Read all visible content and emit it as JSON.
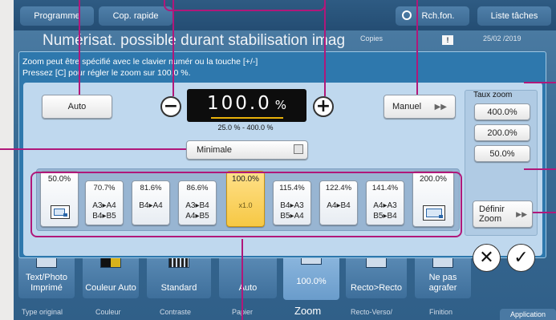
{
  "topbar": {
    "programme": "Programme",
    "cop_rapide": "Cop. rapide",
    "rch_fon": "Rch.fon.",
    "liste_taches": "Liste tâches"
  },
  "title": "Numérisat. possible durant stabilisation imag",
  "copies_label": "Copies",
  "datetime": "25/02 /2019",
  "info_text": [
    "Zoom peut être spécifié avec le clavier numér ou la touche [+/-]",
    "Pressez [C] pour régler le zoom sur 100,0 %."
  ],
  "zoom": {
    "auto_label": "Auto",
    "value": "100.0",
    "unit": "%",
    "range": "25.0 % - 400.0 %",
    "manuel_label": "Manuel",
    "minimale_label": "Minimale"
  },
  "taux_zoom": {
    "title": "Taux zoom",
    "rates": [
      "400.0%",
      "200.0%",
      "50.0%"
    ],
    "definir_label": "Définir Zoom"
  },
  "presets": [
    {
      "pct": "50.0%",
      "lines": []
    },
    {
      "pct": "70.7%",
      "lines": [
        "A3▸A4",
        "B4▸B5"
      ]
    },
    {
      "pct": "81.6%",
      "lines": [
        "B4▸A4"
      ]
    },
    {
      "pct": "86.6%",
      "lines": [
        "A3▸B4",
        "A4▸B5"
      ]
    },
    {
      "pct": "100.0%",
      "lines": [
        "x1.0"
      ]
    },
    {
      "pct": "115.4%",
      "lines": [
        "B4▸A3",
        "B5▸A4"
      ]
    },
    {
      "pct": "122.4%",
      "lines": [
        "A4▸B4"
      ]
    },
    {
      "pct": "141.4%",
      "lines": [
        "A4▸A3",
        "B5▸B4"
      ]
    },
    {
      "pct": "200.0%",
      "lines": []
    }
  ],
  "bottom": {
    "tiles": [
      "Text/Photo Imprimé",
      "Couleur Auto",
      "Standard",
      "Auto",
      "100.0%",
      "Recto>Recto",
      "Ne pas agrafer"
    ],
    "categories": [
      "Type original",
      "Couleur",
      "Contraste",
      "Papier",
      "Zoom",
      "Recto-Verso/",
      "Finition"
    ],
    "application": "Application"
  },
  "icons": {
    "cancel": "close-icon",
    "ok": "check-icon",
    "minus": "minus-icon",
    "plus": "plus-icon"
  },
  "colors": {
    "accent_selected": "#f6c844",
    "annotation": "#b0187a",
    "panel_blue": "#2e78ad"
  }
}
